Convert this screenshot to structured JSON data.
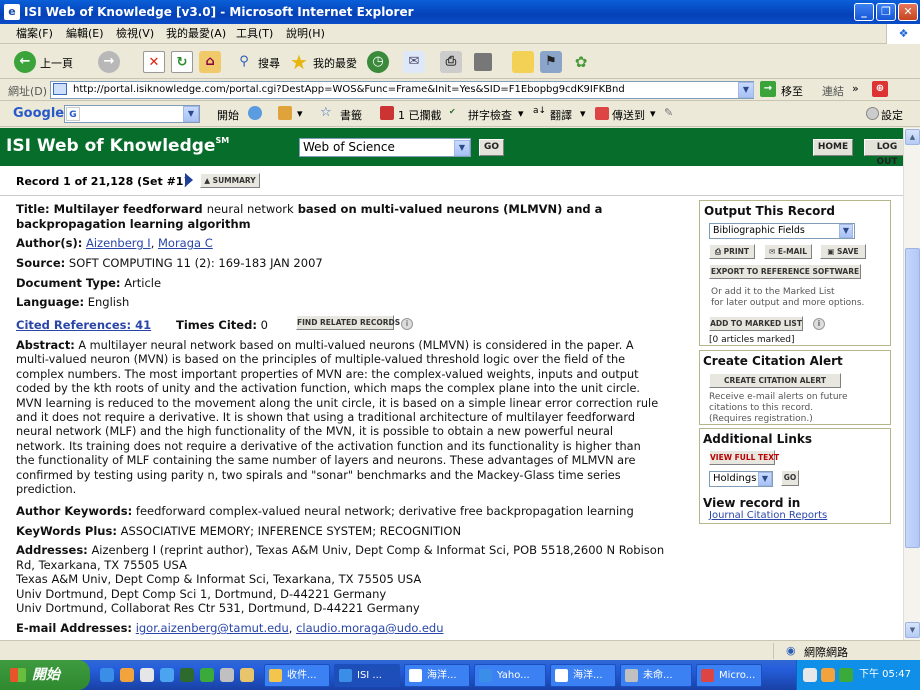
{
  "window": {
    "title": "ISI Web of Knowledge [v3.0] - Microsoft Internet Explorer"
  },
  "menu": [
    "檔案(F)",
    "編輯(E)",
    "檢視(V)",
    "我的最愛(A)",
    "工具(T)",
    "說明(H)"
  ],
  "toolbar": {
    "back": "上一頁",
    "search": "搜尋",
    "favorites": "我的最愛"
  },
  "address": {
    "label": "網址(D)",
    "url": "http://portal.isiknowledge.com/portal.cgi?DestApp=WOS&Func=Frame&Init=Yes&SID=F1Ebopbg9cdK9IFKBnd",
    "go": "移至",
    "links": "連結"
  },
  "google_bar": {
    "logo": "Google",
    "search_btn": "開始",
    "bookmarks": "書籤",
    "blocked": "1 已攔截",
    "spellcheck": "拼字檢查",
    "translate": "翻譯",
    "sendto": "傳送到",
    "settings": "設定"
  },
  "isi": {
    "brand": "ISI Web of Knowledge",
    "brand_sup": "SM",
    "database": "Web of Science",
    "go": "GO",
    "home": "HOME",
    "logout": "LOG OUT"
  },
  "record": {
    "position": "Record 1 of 21,128 (Set #1)",
    "summary_btn": "SUMMARY",
    "title_label": "Title:",
    "title_line1_a": "Multilayer feedforward",
    "title_line1_b": "neural network",
    "title_line1_c": "based on multi-valued neurons (MLMVN) and a",
    "title_line2": "backpropagation learning algorithm",
    "authors_label": "Author(s):",
    "author1": "Aizenberg I",
    "author2": "Moraga C",
    "source_label": "Source:",
    "source": "SOFT COMPUTING 11 (2): 169-183 JAN 2007",
    "doctype_label": "Document Type:",
    "doctype": "Article",
    "language_label": "Language:",
    "language": "English",
    "cited_refs": "Cited References: 41",
    "times_cited_label": "Times Cited:",
    "times_cited": "0",
    "find_related": "FIND RELATED RECORDS",
    "abstract_label": "Abstract:",
    "abstract_lines": [
      "A multilayer neural network based on multi-valued neurons (MLMVN) is considered in the paper. A",
      "multi-valued neuron (MVN) is based on the principles of multiple-valued threshold logic over the field of the",
      "complex numbers. The most important properties of MVN are: the complex-valued weights, inputs and output",
      "coded by the kth roots of unity and the activation function, which maps the complex plane into the unit circle.",
      "MVN learning is reduced to the movement along the unit circle, it is based on a simple linear error correction rule",
      "and it does not require a derivative. It is shown that using a traditional architecture of multilayer feedforward",
      "neural network (MLF) and the high functionality of the MVN, it is possible to obtain a new powerful neural",
      "network. Its training does not require a derivative of the activation function and its functionality is higher than",
      "the functionality of MLF containing the same number of layers and neurons. These advantages of MLMVN are",
      "confirmed by testing using parity n, two spirals and \"sonar\" benchmarks and the Mackey-Glass time series",
      "prediction."
    ],
    "author_kw_label": "Author Keywords:",
    "author_kw": "feedforward complex-valued neural network; derivative free backpropagation learning",
    "kwplus_label": "KeyWords Plus:",
    "kwplus": "ASSOCIATIVE MEMORY; INFERENCE SYSTEM; RECOGNITION",
    "addresses_label": "Addresses:",
    "addr_line1": "Aizenberg I (reprint author), Texas A&M Univ, Dept Comp & Informat Sci, POB 5518,2600 N Robison",
    "addr_line2": "Rd, Texarkana, TX 75505 USA",
    "addr_line3": "Texas A&M Univ, Dept Comp & Informat Sci, Texarkana, TX 75505 USA",
    "addr_line4": "Univ Dortmund, Dept Comp Sci 1, Dortmund, D-44221 Germany",
    "addr_line5": "Univ Dortmund, Collaborat Res Ctr 531, Dortmund, D-44221 Germany",
    "email_label": "E-mail Addresses:",
    "email1": "igor.aizenberg@tamut.edu",
    "email2": "claudio.moraga@udo.edu"
  },
  "sidebar": {
    "output_title": "Output This Record",
    "output_select": "Bibliographic Fields",
    "print": "PRINT",
    "email": "E-MAIL",
    "save": "SAVE",
    "export": "EXPORT TO REFERENCE SOFTWARE",
    "marked_note1": "Or add it to the Marked List",
    "marked_note2": "for later output and more options.",
    "add_marked": "ADD TO MARKED LIST",
    "articles_marked": "[0 articles marked]",
    "citation_title": "Create Citation Alert",
    "citation_btn": "CREATE CITATION ALERT",
    "cit_note1": "Receive e-mail alerts on future",
    "cit_note2": "citations to this record.",
    "cit_note3": "(Requires registration.)",
    "links_title": "Additional Links",
    "fulltext": "VIEW FULL TEXT",
    "holdings": "Holdings",
    "go": "GO",
    "viewin_title": "View record in",
    "jcr": "Journal Citation Reports"
  },
  "status": {
    "zone": "網際網路"
  },
  "taskbar": {
    "start": "開始",
    "tasks": [
      "收件...",
      "ISI ...",
      "海洋...",
      "Yaho...",
      "海洋...",
      "未命...",
      "Micro..."
    ],
    "clock": "下午 05:47"
  }
}
